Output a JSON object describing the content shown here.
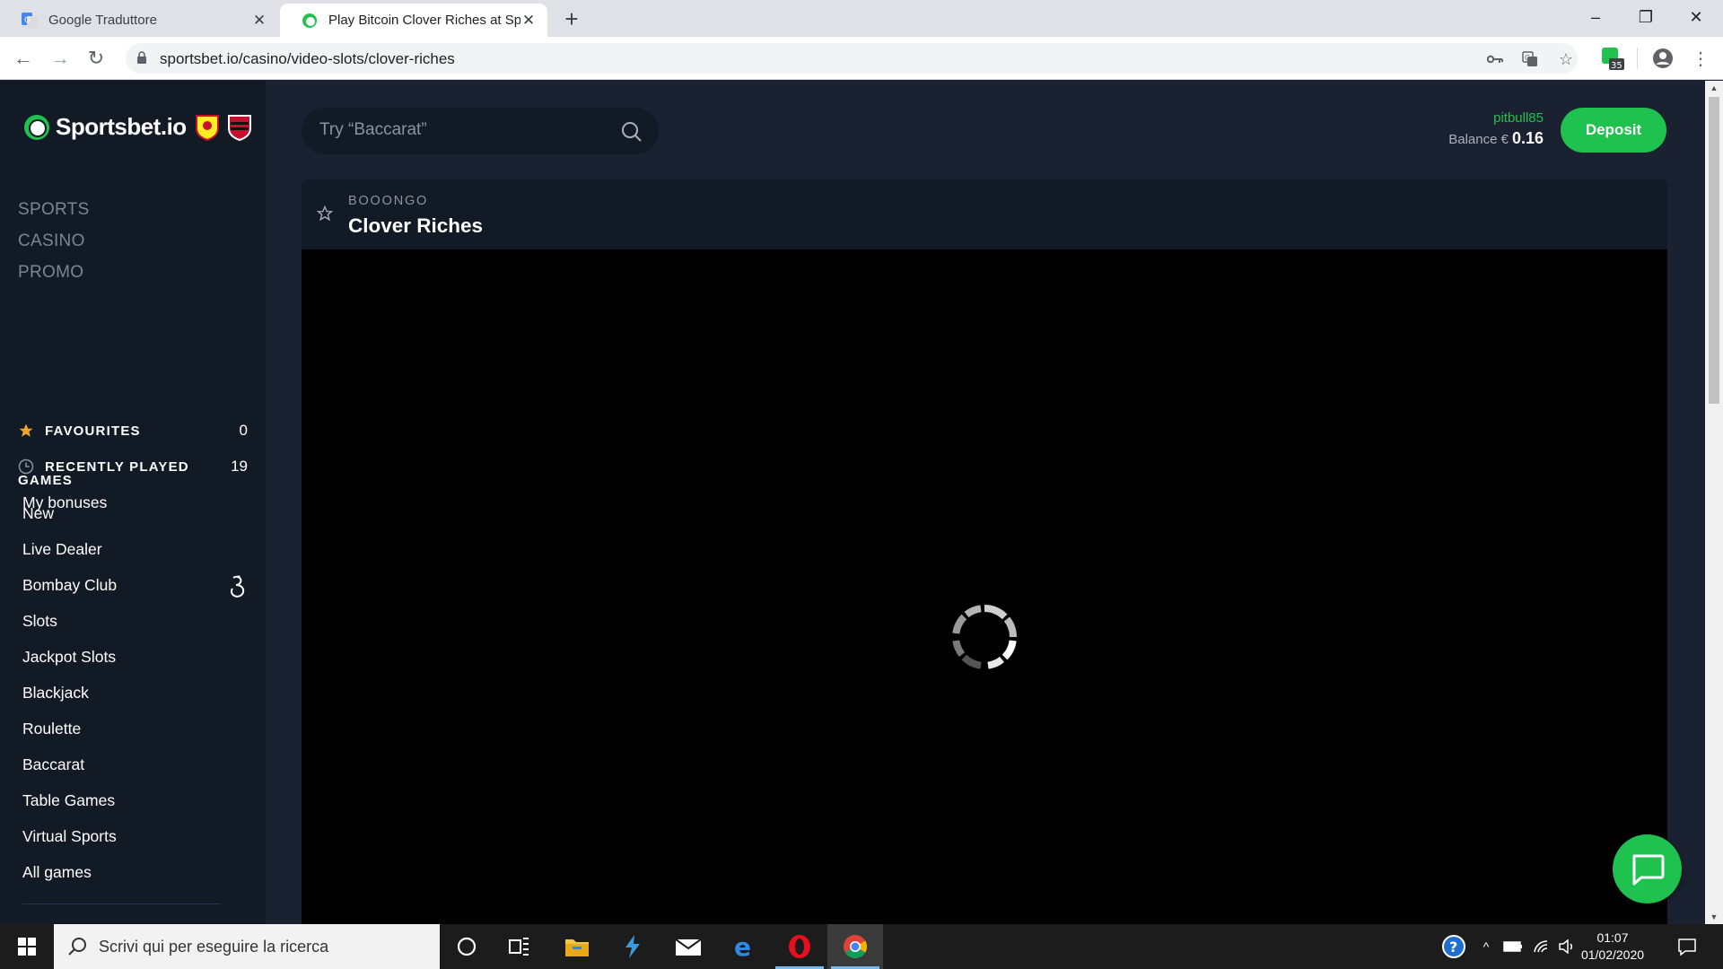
{
  "browser": {
    "tabs": [
      {
        "title": "Google Traduttore",
        "active": false
      },
      {
        "title": "Play Bitcoin Clover Riches at Spor",
        "active": true
      }
    ],
    "url": "sportsbet.io/casino/video-slots/clover-riches",
    "extension_badge": "35"
  },
  "site": {
    "logo_text": "Sportsbet.io",
    "main_nav": [
      "SPORTS",
      "CASINO",
      "PROMO"
    ],
    "favourites": {
      "label": "FAVOURITES",
      "count": "0"
    },
    "recently_played": {
      "label": "RECENTLY PLAYED",
      "count": "19"
    },
    "my_bonuses": "My bonuses",
    "games_title": "GAMES",
    "games": [
      "New",
      "Live Dealer",
      "Bombay Club",
      "Slots",
      "Jackpot Slots",
      "Blackjack",
      "Roulette",
      "Baccarat",
      "Table Games",
      "Virtual Sports",
      "All games"
    ],
    "search_placeholder": "Try “Baccarat”",
    "username": "pitbull85",
    "balance_label": "Balance €",
    "balance_value": "0.16",
    "deposit_label": "Deposit",
    "game": {
      "provider": "BOOONGO",
      "title": "Clover Riches"
    },
    "colors": {
      "accent": "#1fc24f",
      "sidebar": "#121a26",
      "background": "#1a2130"
    }
  },
  "taskbar": {
    "search_placeholder": "Scrivi qui per eseguire la ricerca",
    "time": "01:07",
    "date": "01/02/2020"
  }
}
